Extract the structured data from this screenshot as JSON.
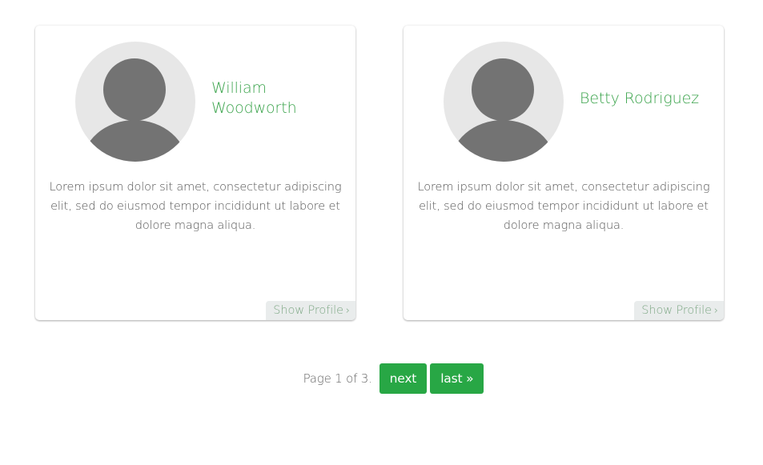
{
  "profiles": [
    {
      "name": "William Woodworth",
      "description": "Lorem ipsum dolor sit amet, consectetur adipiscing elit, sed do eiusmod tempor incididunt ut labore et dolore magna aliqua.",
      "link_label": "Show Profile",
      "link_chevron": "›"
    },
    {
      "name": "Betty Rodriguez",
      "description": "Lorem ipsum dolor sit amet, consectetur adipiscing elit, sed do eiusmod tempor incididunt ut labore et dolore magna aliqua.",
      "link_label": "Show Profile",
      "link_chevron": "›"
    }
  ],
  "pagination": {
    "info": "Page 1 of 3.",
    "next_label": "next",
    "last_label": "last »"
  },
  "colors": {
    "accent": "#3aa34b",
    "button": "#28a745",
    "avatar_bg": "#e7e7e7",
    "avatar_fg": "#737373",
    "link_bg": "#e9ecec",
    "link_text": "#7fa886"
  },
  "icons": {
    "avatar": "user-silhouette-icon",
    "chevron": "chevron-right-icon"
  }
}
